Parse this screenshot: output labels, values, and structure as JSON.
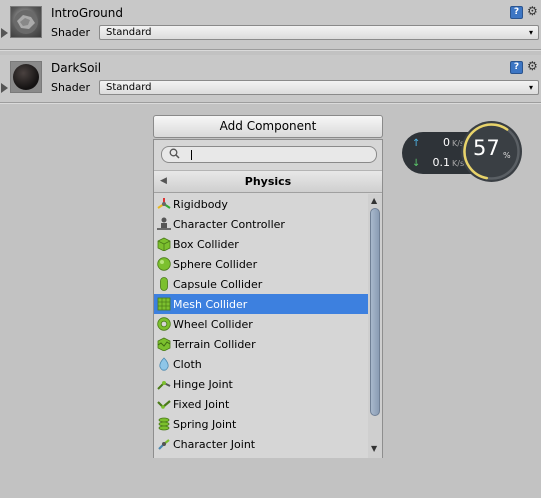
{
  "materials": [
    {
      "name": "IntroGround",
      "shader_label": "Shader",
      "shader_value": "Standard"
    },
    {
      "name": "DarkSoil",
      "shader_label": "Shader",
      "shader_value": "Standard"
    }
  ],
  "icons": {
    "help": "?",
    "gear": "⚙",
    "dropdown_caret": "▾"
  },
  "add_component": {
    "button_label": "Add Component",
    "search_value": "",
    "category_title": "Physics",
    "items": [
      {
        "label": "Rigidbody",
        "icon": "rigidbody-icon",
        "selected": false
      },
      {
        "label": "Character Controller",
        "icon": "character-controller-icon",
        "selected": false
      },
      {
        "label": "Box Collider",
        "icon": "box-collider-icon",
        "selected": false
      },
      {
        "label": "Sphere Collider",
        "icon": "sphere-collider-icon",
        "selected": false
      },
      {
        "label": "Capsule Collider",
        "icon": "capsule-collider-icon",
        "selected": false
      },
      {
        "label": "Mesh Collider",
        "icon": "mesh-collider-icon",
        "selected": true
      },
      {
        "label": "Wheel Collider",
        "icon": "wheel-collider-icon",
        "selected": false
      },
      {
        "label": "Terrain Collider",
        "icon": "terrain-collider-icon",
        "selected": false
      },
      {
        "label": "Cloth",
        "icon": "cloth-icon",
        "selected": false
      },
      {
        "label": "Hinge Joint",
        "icon": "hinge-joint-icon",
        "selected": false
      },
      {
        "label": "Fixed Joint",
        "icon": "fixed-joint-icon",
        "selected": false
      },
      {
        "label": "Spring Joint",
        "icon": "spring-joint-icon",
        "selected": false
      },
      {
        "label": "Character Joint",
        "icon": "character-joint-icon",
        "selected": false
      }
    ]
  },
  "network_monitor": {
    "upload_value": "0",
    "upload_unit": "K/s",
    "download_value": "0.1",
    "download_unit": "K/s",
    "percent_value": "57",
    "percent_unit": "%",
    "percent_fraction": 0.57
  },
  "colors": {
    "selection": "#3d80df",
    "collider_green": "#7cc02e",
    "upload_arrow": "#4fb6e8",
    "download_arrow": "#5cc96b",
    "ring": "#e8d36a"
  }
}
